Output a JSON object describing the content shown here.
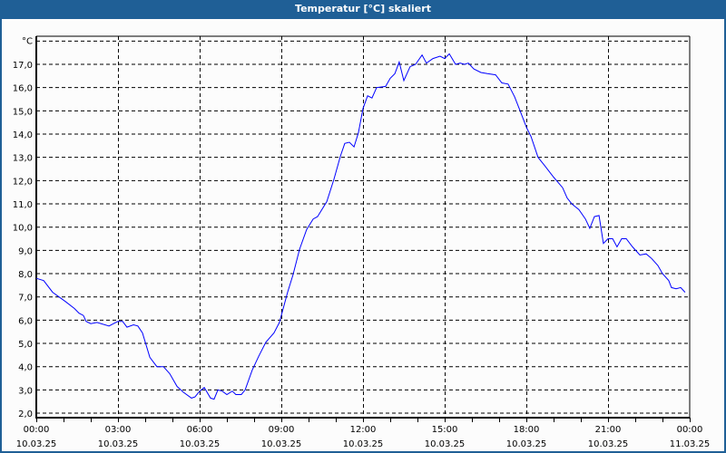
{
  "window": {
    "title": "Temperatur [°C] skaliert"
  },
  "chart_data": {
    "type": "line",
    "title": "Temperatur [°C] skaliert",
    "ylabel": "°C",
    "xlabel": "",
    "ylim": [
      1.8,
      18.0
    ],
    "xlim_hours": [
      0,
      24
    ],
    "grid": true,
    "yticks": [
      {
        "v": 2,
        "label": "2,0"
      },
      {
        "v": 3,
        "label": "3,0"
      },
      {
        "v": 4,
        "label": "4,0"
      },
      {
        "v": 5,
        "label": "5,0"
      },
      {
        "v": 6,
        "label": "6,0"
      },
      {
        "v": 7,
        "label": "7,0"
      },
      {
        "v": 8,
        "label": "8,0"
      },
      {
        "v": 9,
        "label": "9,0"
      },
      {
        "v": 10,
        "label": "10,0"
      },
      {
        "v": 11,
        "label": "11,0"
      },
      {
        "v": 12,
        "label": "12,0"
      },
      {
        "v": 13,
        "label": "13,0"
      },
      {
        "v": 14,
        "label": "14,0"
      },
      {
        "v": 15,
        "label": "15,0"
      },
      {
        "v": 16,
        "label": "16,0"
      },
      {
        "v": 17,
        "label": "17,0"
      }
    ],
    "xticks": [
      {
        "h": 0,
        "time": "00:00",
        "date": "10.03.25"
      },
      {
        "h": 3,
        "time": "03:00",
        "date": "10.03.25"
      },
      {
        "h": 6,
        "time": "06:00",
        "date": "10.03.25"
      },
      {
        "h": 9,
        "time": "09:00",
        "date": "10.03.25"
      },
      {
        "h": 12,
        "time": "12:00",
        "date": "10.03.25"
      },
      {
        "h": 15,
        "time": "15:00",
        "date": "10.03.25"
      },
      {
        "h": 18,
        "time": "18:00",
        "date": "10.03.25"
      },
      {
        "h": 21,
        "time": "21:00",
        "date": "10.03.25"
      },
      {
        "h": 24,
        "time": "00:00",
        "date": "11.03.25"
      }
    ],
    "series": [
      {
        "name": "Temperatur",
        "color": "#0000ff",
        "x": [
          0,
          0.27,
          0.6,
          1.07,
          1.4,
          1.57,
          1.73,
          1.83,
          2.0,
          2.23,
          2.67,
          3.0,
          3.17,
          3.33,
          3.57,
          3.73,
          3.9,
          4.17,
          4.43,
          4.67,
          4.9,
          5.17,
          5.4,
          5.7,
          5.83,
          6.0,
          6.17,
          6.4,
          6.53,
          6.67,
          6.83,
          7.0,
          7.2,
          7.33,
          7.53,
          7.67,
          7.93,
          8.17,
          8.43,
          8.73,
          8.93,
          9.23,
          9.43,
          9.67,
          9.93,
          10.17,
          10.33,
          10.67,
          10.93,
          11.17,
          11.33,
          11.5,
          11.67,
          11.83,
          12.0,
          12.17,
          12.33,
          12.5,
          12.83,
          13.0,
          13.17,
          13.33,
          13.5,
          13.73,
          13.93,
          14.17,
          14.33,
          14.57,
          14.83,
          15.0,
          15.17,
          15.4,
          15.57,
          15.73,
          15.87,
          16.07,
          16.33,
          16.57,
          16.87,
          17.1,
          17.33,
          17.57,
          17.77,
          18.0,
          18.17,
          18.43,
          18.67,
          19.0,
          19.33,
          19.5,
          19.67,
          19.93,
          20.17,
          20.33,
          20.5,
          20.67,
          20.83,
          21.0,
          21.17,
          21.33,
          21.5,
          21.67,
          21.9,
          22.17,
          22.4,
          22.6,
          22.83,
          23.0,
          23.23,
          23.33,
          23.5,
          23.67,
          23.83
        ],
        "y": [
          7.8,
          7.7,
          7.2,
          6.8,
          6.5,
          6.3,
          6.2,
          5.95,
          5.85,
          5.9,
          5.75,
          5.95,
          5.95,
          5.7,
          5.8,
          5.75,
          5.45,
          4.4,
          4.0,
          4.0,
          3.7,
          3.15,
          2.9,
          2.65,
          2.7,
          2.95,
          3.1,
          2.65,
          2.6,
          3.0,
          2.95,
          2.8,
          2.95,
          2.8,
          2.8,
          3.0,
          3.85,
          4.45,
          5.05,
          5.45,
          5.9,
          7.2,
          7.95,
          9.05,
          9.9,
          10.35,
          10.45,
          11.1,
          12.05,
          13.05,
          13.6,
          13.65,
          13.45,
          14.05,
          15.1,
          15.65,
          15.55,
          16.0,
          16.05,
          16.4,
          16.6,
          17.1,
          16.3,
          16.9,
          17.0,
          17.4,
          17.05,
          17.25,
          17.35,
          17.25,
          17.45,
          17.0,
          17.05,
          17.0,
          17.05,
          16.8,
          16.65,
          16.6,
          16.55,
          16.2,
          16.15,
          15.6,
          15.0,
          14.3,
          13.9,
          13.0,
          12.65,
          12.15,
          11.7,
          11.25,
          11.0,
          10.75,
          10.35,
          9.95,
          10.45,
          10.5,
          9.3,
          9.5,
          9.5,
          9.15,
          9.5,
          9.5,
          9.15,
          8.8,
          8.85,
          8.65,
          8.35,
          8.0,
          7.7,
          7.4,
          7.35,
          7.4,
          7.2
        ]
      }
    ]
  }
}
